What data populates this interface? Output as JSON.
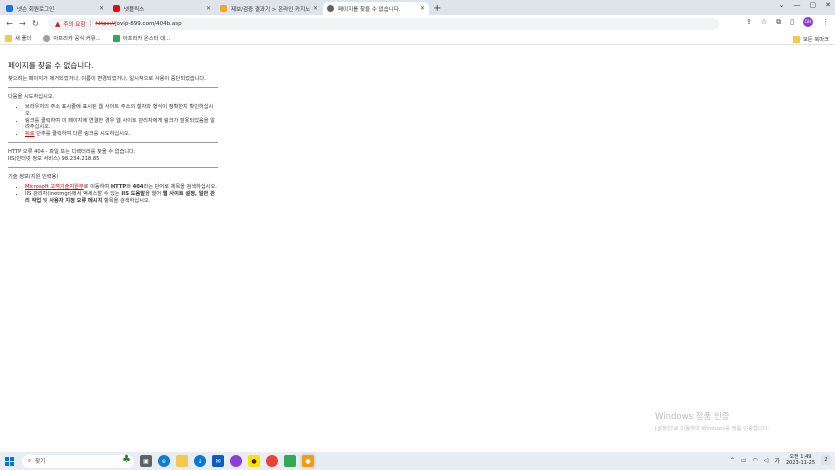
{
  "browser": {
    "tabs": [
      {
        "label": "넷슨 회원로그인",
        "favicon_color": "#1a73e8",
        "active": false
      },
      {
        "label": "넷플릭스",
        "favicon_color": "#e50914",
        "active": false
      },
      {
        "label": "제보/검증 결과기 > 온라인 카지노...",
        "favicon_color": "#f5a623",
        "active": false
      },
      {
        "label": "페이지를 찾을 수 없습니다.",
        "favicon_color": "#5f6368",
        "active": true
      }
    ],
    "new_tab_label": "+",
    "toolbar": {
      "back_label": "←",
      "forward_label": "→",
      "reload_label": "↻",
      "security_warning": "주의 요함",
      "url_scheme": "https://",
      "url_rest": "jovip-899.com/404b.asp",
      "avatar_initials": "GH"
    },
    "bookmarks": [
      {
        "label": "새 폴더",
        "icon_color": "#f2c94c"
      },
      {
        "label": "아프리카 공식 커뮤...",
        "icon_color": "#9aa0a6"
      },
      {
        "label": "아프리카 온스타 데...",
        "icon_color": "#34a853"
      }
    ],
    "bookmarks_right_label": "모든 북마크"
  },
  "page": {
    "heading": "페이지를 찾을 수 없습니다.",
    "intro": "찾으려는 페이지가 제거되었거나, 이름이 변경되었거나, 일시적으로 사용이 중단되었습니다.",
    "try_heading": "다음을 시도하십시오.",
    "try_items": [
      "브라우저의 주소 표시줄에 표시된 웹 사이트 주소의 철자와 형식이 정확한지 확인하십시오.",
      "링크를 클릭하여 이 페이지에 연결한 경우 웹 사이트 관리자에게 링크가 잘못되었음을 알려주십시오."
    ],
    "back_link": "뒤로",
    "back_suffix": " 단추를 클릭하여 다른 링크를 시도하십시오.",
    "error_line1": "HTTP 오류 404 - 파일 또는 디렉터리를 찾을 수 없습니다.",
    "error_line2": "IIS(인터넷 정보 서비스) 98.234.218.85",
    "tech_heading": "기술 정보(지원 인력용)",
    "tech_item1_link": "Microsoft 고객기술지원부",
    "tech_item1_mid": "로 이동하여 ",
    "tech_item1_bold1": "HTTP",
    "tech_item1_mid2": "와 ",
    "tech_item1_bold2": "404",
    "tech_item1_end": "라는 단어로 제목을 검색하십시오.",
    "tech_item2_start": "IIS 관리자(inetmgr)에서 액세스할 수 있는 ",
    "tech_item2_bold1": "IIS 도움말",
    "tech_item2_mid": "을 열어 ",
    "tech_item2_bold2": "웹 사이트 설정, 일반 관리 작업",
    "tech_item2_mid2": " 및 ",
    "tech_item2_bold3": "사용자 지정 오류 메시지",
    "tech_item2_end": " 항목을 검색하십시오."
  },
  "watermark": {
    "title": "Windows 정품 인증",
    "subtitle": "[설정]으로 이동하여 Windows를 정품 인증합니다."
  },
  "taskbar": {
    "search_placeholder": "찾기",
    "time": "오전 1:49",
    "date": "2023-11-25",
    "notification_count": "2"
  }
}
